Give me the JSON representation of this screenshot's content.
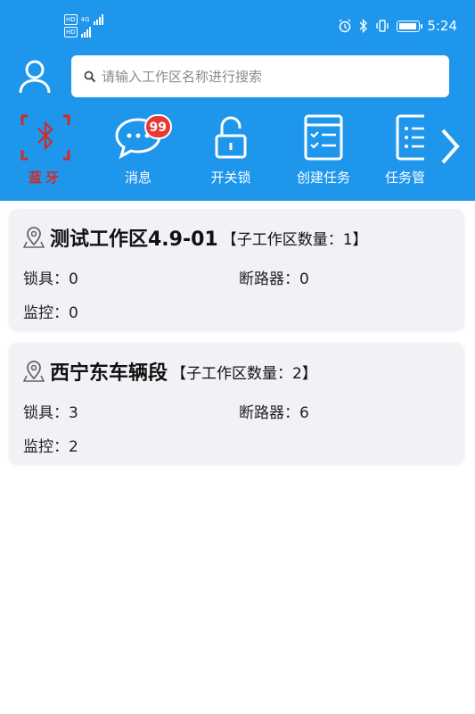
{
  "status_bar": {
    "sim1": "HD",
    "sim2": "HD",
    "network": "4G",
    "time": "5:24"
  },
  "header": {
    "search_placeholder": "请输入工作区名称进行搜索",
    "nav": [
      {
        "label": "蓝牙",
        "icon": "bluetooth-icon",
        "active": true
      },
      {
        "label": "消息",
        "icon": "message-icon",
        "badge": "99"
      },
      {
        "label": "开关锁",
        "icon": "lock-icon"
      },
      {
        "label": "创建任务",
        "icon": "create-task-icon"
      },
      {
        "label": "任务管",
        "icon": "task-list-icon"
      }
    ]
  },
  "colors": {
    "header_bg": "#1e96ec",
    "active_nav": "#d12b23",
    "badge": "#e53935",
    "card_bg": "#f2f1f5"
  },
  "workspaces": [
    {
      "name": "测试工作区4.9-01",
      "sub_count_text": "【子工作区数量：1】",
      "lock_text": "锁具：0",
      "breaker_text": "断路器：0",
      "monitor_text": "监控：0"
    },
    {
      "name": "西宁东车辆段",
      "sub_count_text": "【子工作区数量：2】",
      "lock_text": "锁具：3",
      "breaker_text": "断路器：6",
      "monitor_text": "监控：2"
    }
  ]
}
